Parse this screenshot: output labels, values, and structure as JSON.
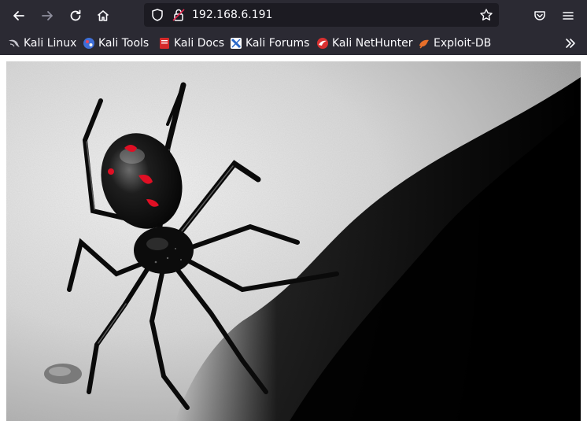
{
  "browser": {
    "url": "192.168.6.191",
    "bookmarks": [
      {
        "label": "Kali Linux",
        "icon": "kali-dragon-icon"
      },
      {
        "label": "Kali Tools",
        "icon": "kali-tools-icon"
      },
      {
        "label": "Kali Docs",
        "icon": "kali-docs-icon"
      },
      {
        "label": "Kali Forums",
        "icon": "kali-forums-icon"
      },
      {
        "label": "Kali NetHunter",
        "icon": "kali-nethunter-icon"
      },
      {
        "label": "Exploit-DB",
        "icon": "exploit-db-icon"
      }
    ],
    "colors": {
      "chrome": "#2b2a33",
      "urlbar": "#1c1b22",
      "text": "#fbfbfe"
    }
  },
  "page": {
    "image": {
      "subject": "black widow spider on sand",
      "icon": "spider-photo"
    }
  }
}
